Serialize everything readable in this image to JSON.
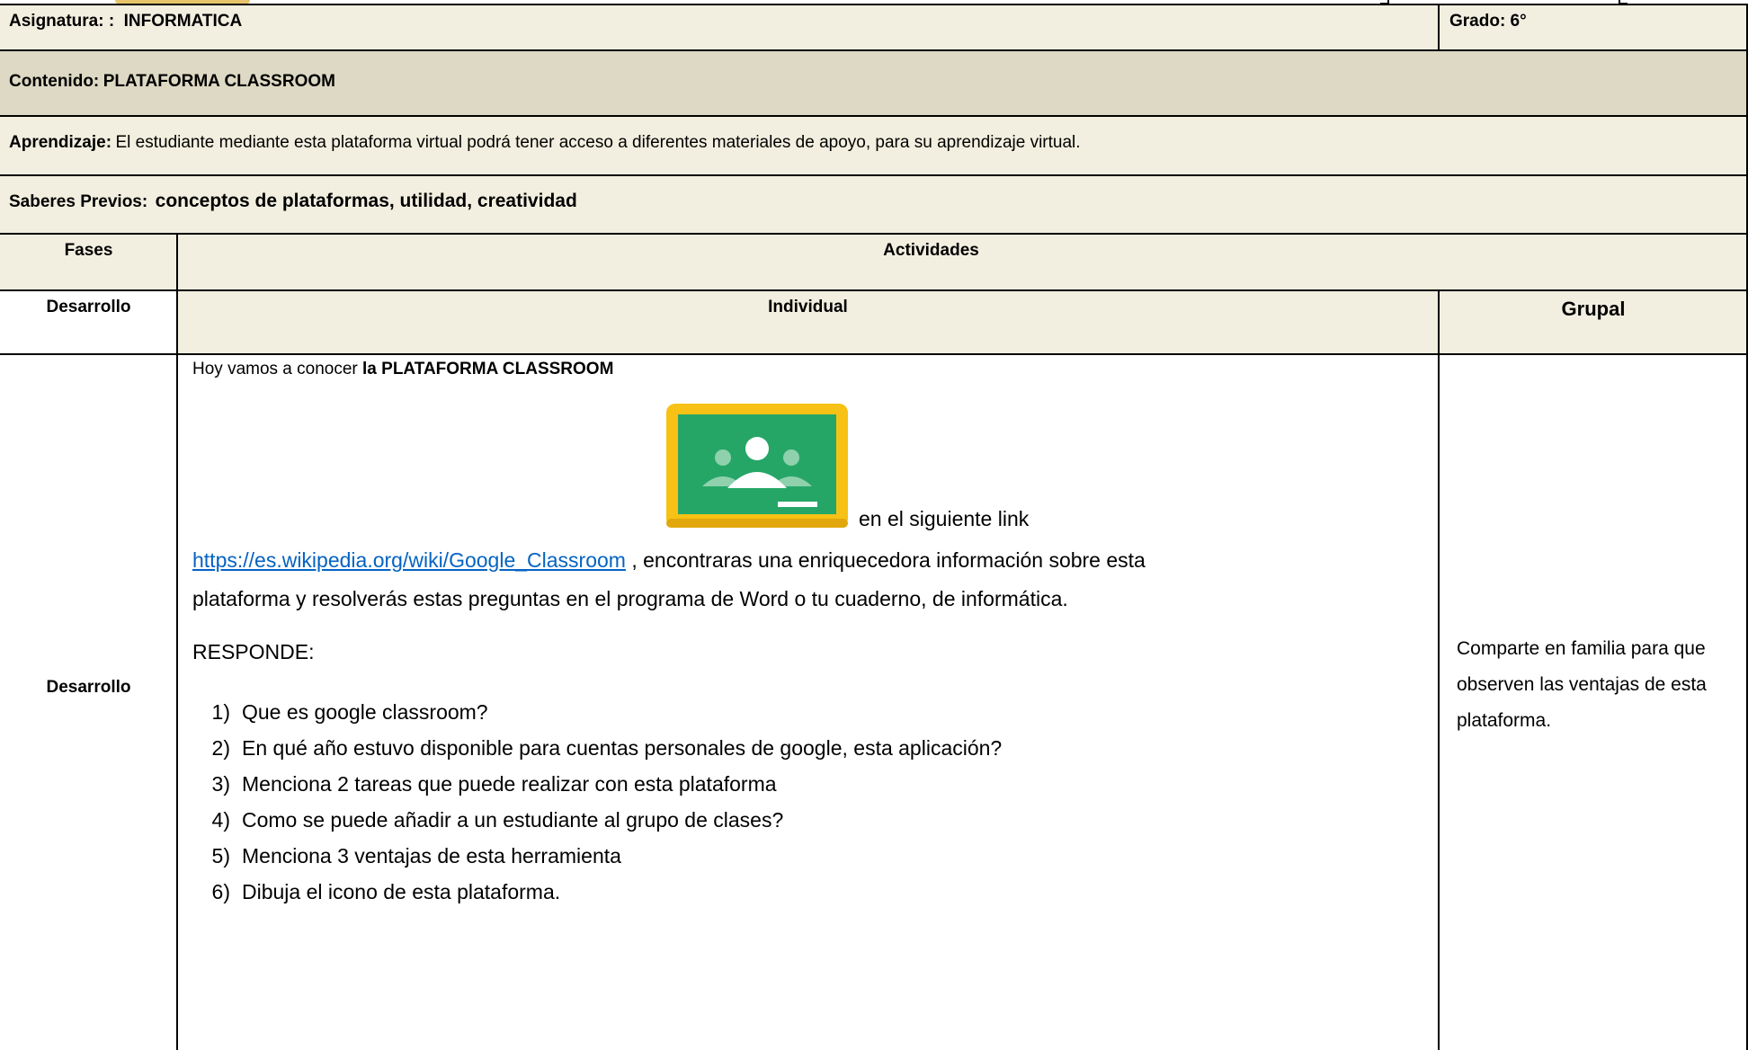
{
  "header": {
    "asignatura_label": "Asignatura: :",
    "asignatura_value": "INFORMATICA",
    "grado": "Grado: 6°"
  },
  "contenido": {
    "label": "Contenido:",
    "value": "PLATAFORMA CLASSROOM"
  },
  "aprendizaje": {
    "label": "Aprendizaje:",
    "value": "El estudiante mediante esta plataforma virtual podrá tener acceso a diferentes materiales de apoyo, para su aprendizaje virtual."
  },
  "saberes": {
    "label": "Saberes Previos:",
    "value": "conceptos de plataformas, utilidad, creatividad"
  },
  "table": {
    "fases_header": "Fases",
    "actividades_header": "Actividades",
    "desarrollo_label": "Desarrollo",
    "individual_header": "Individual",
    "grupal_header": "Grupal",
    "row_label": "Desarrollo"
  },
  "individual": {
    "intro_prefix": "Hoy vamos a conocer",
    "intro_bold": "la PLATAFORMA CLASSROOM",
    "icon": "google-classroom-logo",
    "after_icon": "en el siguiente link",
    "link": "https://es.wikipedia.org/wiki/Google_Classroom",
    "link_suffix": ", encontraras una enriquecedora información sobre esta",
    "line3": "plataforma y resolverás estas  preguntas en el programa de Word o tu cuaderno, de informática.",
    "responde": "RESPONDE:",
    "questions": [
      {
        "num": "1)",
        "text": "Que es google classroom?"
      },
      {
        "num": "2)",
        "text": "En qué año estuvo disponible para cuentas personales de google, esta aplicación?"
      },
      {
        "num": "3)",
        "text": "Menciona 2 tareas que puede realizar con esta plataforma"
      },
      {
        "num": "4)",
        "text": "Como se puede añadir a un estudiante al grupo de clases?"
      },
      {
        "num": "5)",
        "text": "Menciona 3 ventajas de esta herramienta"
      },
      {
        "num": "6)",
        "text": "Dibuja el icono de esta plataforma."
      }
    ]
  },
  "grupal": {
    "text": "Comparte en familia para que observen las ventajas de esta plataforma."
  },
  "colors": {
    "beige": "#f2efe0",
    "tan": "#ddd9c4",
    "link": "#0563c1",
    "classroom_green": "#25a667",
    "classroom_yellow": "#f7c115"
  }
}
